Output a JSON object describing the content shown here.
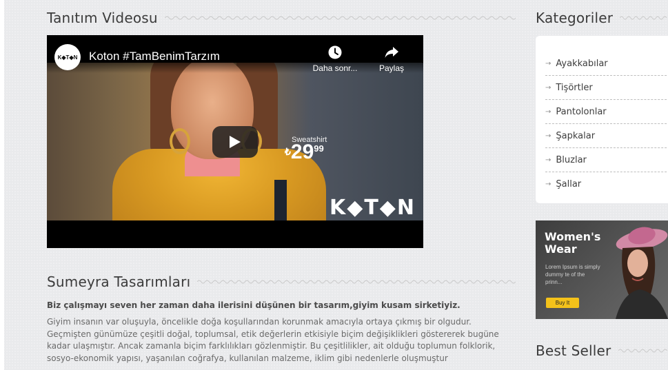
{
  "video_section": {
    "heading": "Tanıtım Videosu",
    "video": {
      "channel_logo_text": "K◆T◆N",
      "title": "Koton #TamBenimTarzım",
      "watch_later_label": "Daha sonr...",
      "share_label": "Paylaş",
      "overlay_label": "Sweatshirt",
      "overlay_currency": "₺",
      "overlay_price_main": "29",
      "overlay_price_decimals": "99",
      "watermark": "K◆T◆N"
    }
  },
  "about_section": {
    "heading": "Sumeyra Tasarımları",
    "tagline": "Biz çalışmayı seven her zaman daha ilerisini düşünen bir tasarım,giyim kusam sirketiyiz.",
    "paragraph": "Giyim insanın var oluşuyla, öncelikle doğa koşullarından korunmak amacıyla ortaya çıkmış bir olgudur. Geçmişten günümüze çeşitli doğal, toplumsal, etik değerlerin etkisiyle biçim değişiklikleri göstererek bugüne kadar ulaşmıştır. Ancak zamanla biçim farklılıkları gözlenmiştir. Bu çeşitlilikler, ait olduğu toplumun folklorik, sosyo-ekonomik yapısı, yaşanılan coğrafya, kullanılan malzeme, iklim gibi nedenlerle oluşmuştur"
  },
  "sidebar": {
    "categories_heading": "Kategoriler",
    "categories": [
      {
        "label": "Ayakkabılar"
      },
      {
        "label": "Tişörtler"
      },
      {
        "label": "Pantolonlar"
      },
      {
        "label": "Şapkalar"
      },
      {
        "label": "Bluzlar"
      },
      {
        "label": "Şallar"
      }
    ],
    "banner": {
      "title": "Women's Wear",
      "text": "Lorem Ipsum is simply dummy te of the prinn...",
      "button_label": "Buy It"
    },
    "best_seller_heading": "Best Seller"
  },
  "colors": {
    "background": "#e9eaec",
    "banner_button": "#f4c21a",
    "heading": "#3b3b3b"
  }
}
